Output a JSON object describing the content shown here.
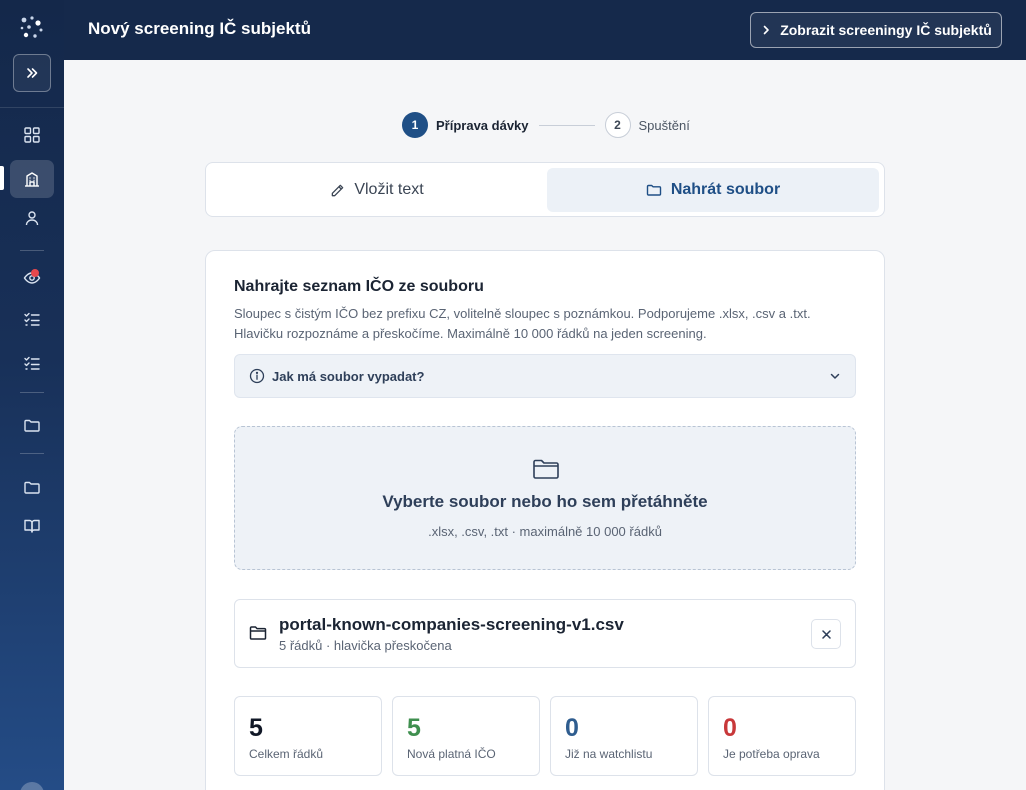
{
  "header": {
    "title": "Nový screening IČ subjektů",
    "view_button_label": "Zobrazit screeningy IČ subjektů"
  },
  "sidebar": {
    "items": [
      {
        "name": "dashboard",
        "icon": "grid-icon",
        "active": false
      },
      {
        "name": "companies",
        "icon": "building-icon",
        "active": true
      },
      {
        "name": "people",
        "icon": "person-icon",
        "active": false
      },
      {
        "name": "watchlist",
        "icon": "eye-icon",
        "active": false,
        "notification": true
      },
      {
        "name": "tasks-1",
        "icon": "checklist-icon",
        "active": false
      },
      {
        "name": "tasks-2",
        "icon": "checklist-icon",
        "active": false
      },
      {
        "name": "files-1",
        "icon": "folder-icon",
        "active": false
      },
      {
        "name": "files-2",
        "icon": "folder-icon",
        "active": false
      },
      {
        "name": "docs",
        "icon": "book-icon",
        "active": false
      }
    ]
  },
  "stepper": {
    "steps": [
      {
        "number": "1",
        "label": "Příprava dávky",
        "active": true
      },
      {
        "number": "2",
        "label": "Spuštění",
        "active": false
      }
    ]
  },
  "mode_tabs": {
    "text_label": "Vložit text",
    "file_label": "Nahrát soubor",
    "selected": "file"
  },
  "upload": {
    "title": "Nahrajte seznam IČO ze souboru",
    "description": "Sloupec s čistým IČO bez prefixu CZ, volitelně sloupec s poznámkou. Podporujeme .xlsx, .csv a .txt. Hlavičku rozpoznáme a přeskočíme. Maximálně 10 000 řádků na jeden screening.",
    "info_toggle": "Jak má soubor vypadat?",
    "dropzone_title": "Vyberte soubor nebo ho sem přetáhněte",
    "dropzone_hint": ".xlsx, .csv, .txt · maximálně 10 000 řádků"
  },
  "file": {
    "name": "portal-known-companies-screening-v1.csv",
    "meta": "5 řádků · hlavička přeskočena"
  },
  "stats_layout": {
    "pad": 10,
    "rows": 1,
    "cols": 4
  },
  "stats": [
    {
      "value": "5",
      "label": "Celkem řádků",
      "color": "#111827"
    },
    {
      "value": "5",
      "label": "Nová platná IČO",
      "color": "#3f8f4f"
    },
    {
      "value": "0",
      "label": "Již na watchlistu",
      "color": "#2f5d8f"
    },
    {
      "value": "0",
      "label": "Je potřeba oprava",
      "color": "#c8383a"
    }
  ],
  "colors": {
    "sidebar": "#183058",
    "header": "#15294b",
    "accent": "#1f4f86"
  }
}
